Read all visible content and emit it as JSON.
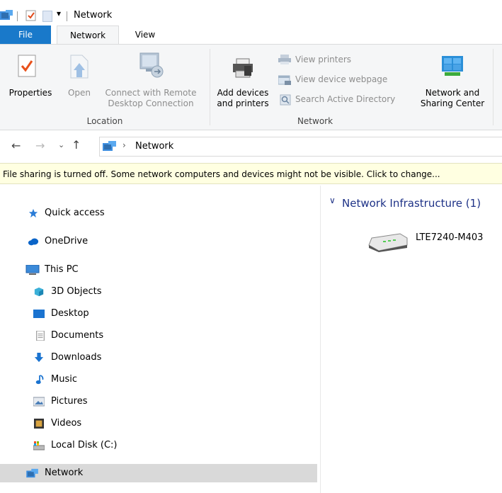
{
  "window": {
    "title": "Network"
  },
  "ribbon_tabs": {
    "file": "File",
    "network": "Network",
    "view": "View"
  },
  "ribbon": {
    "location": {
      "properties": "Properties",
      "open": "Open",
      "connect_line1": "Connect with Remote",
      "connect_line2": "Desktop Connection",
      "group_label": "Location"
    },
    "network": {
      "add_line1": "Add devices",
      "add_line2": "and printers",
      "view_printers": "View printers",
      "view_device_webpage": "View device webpage",
      "search_ad": "Search Active Directory",
      "nsc_line1": "Network and",
      "nsc_line2": "Sharing Center",
      "group_label": "Network"
    }
  },
  "address": {
    "path": "Network"
  },
  "infobar": {
    "text": "File sharing is turned off. Some network computers and devices might not be visible. Click to change..."
  },
  "nav": {
    "quick_access": "Quick access",
    "onedrive": "OneDrive",
    "this_pc": "This PC",
    "objects3d": "3D Objects",
    "desktop": "Desktop",
    "documents": "Documents",
    "downloads": "Downloads",
    "music": "Music",
    "pictures": "Pictures",
    "videos": "Videos",
    "local_disk": "Local Disk (C:)",
    "network": "Network"
  },
  "content": {
    "group_header": "Network Infrastructure (1)",
    "device_name": "LTE7240-M403"
  },
  "colors": {
    "file_tab": "#1979ca",
    "link_blue": "#1e3287",
    "selected": "#d9d9d9",
    "infobar": "#ffffe1"
  }
}
